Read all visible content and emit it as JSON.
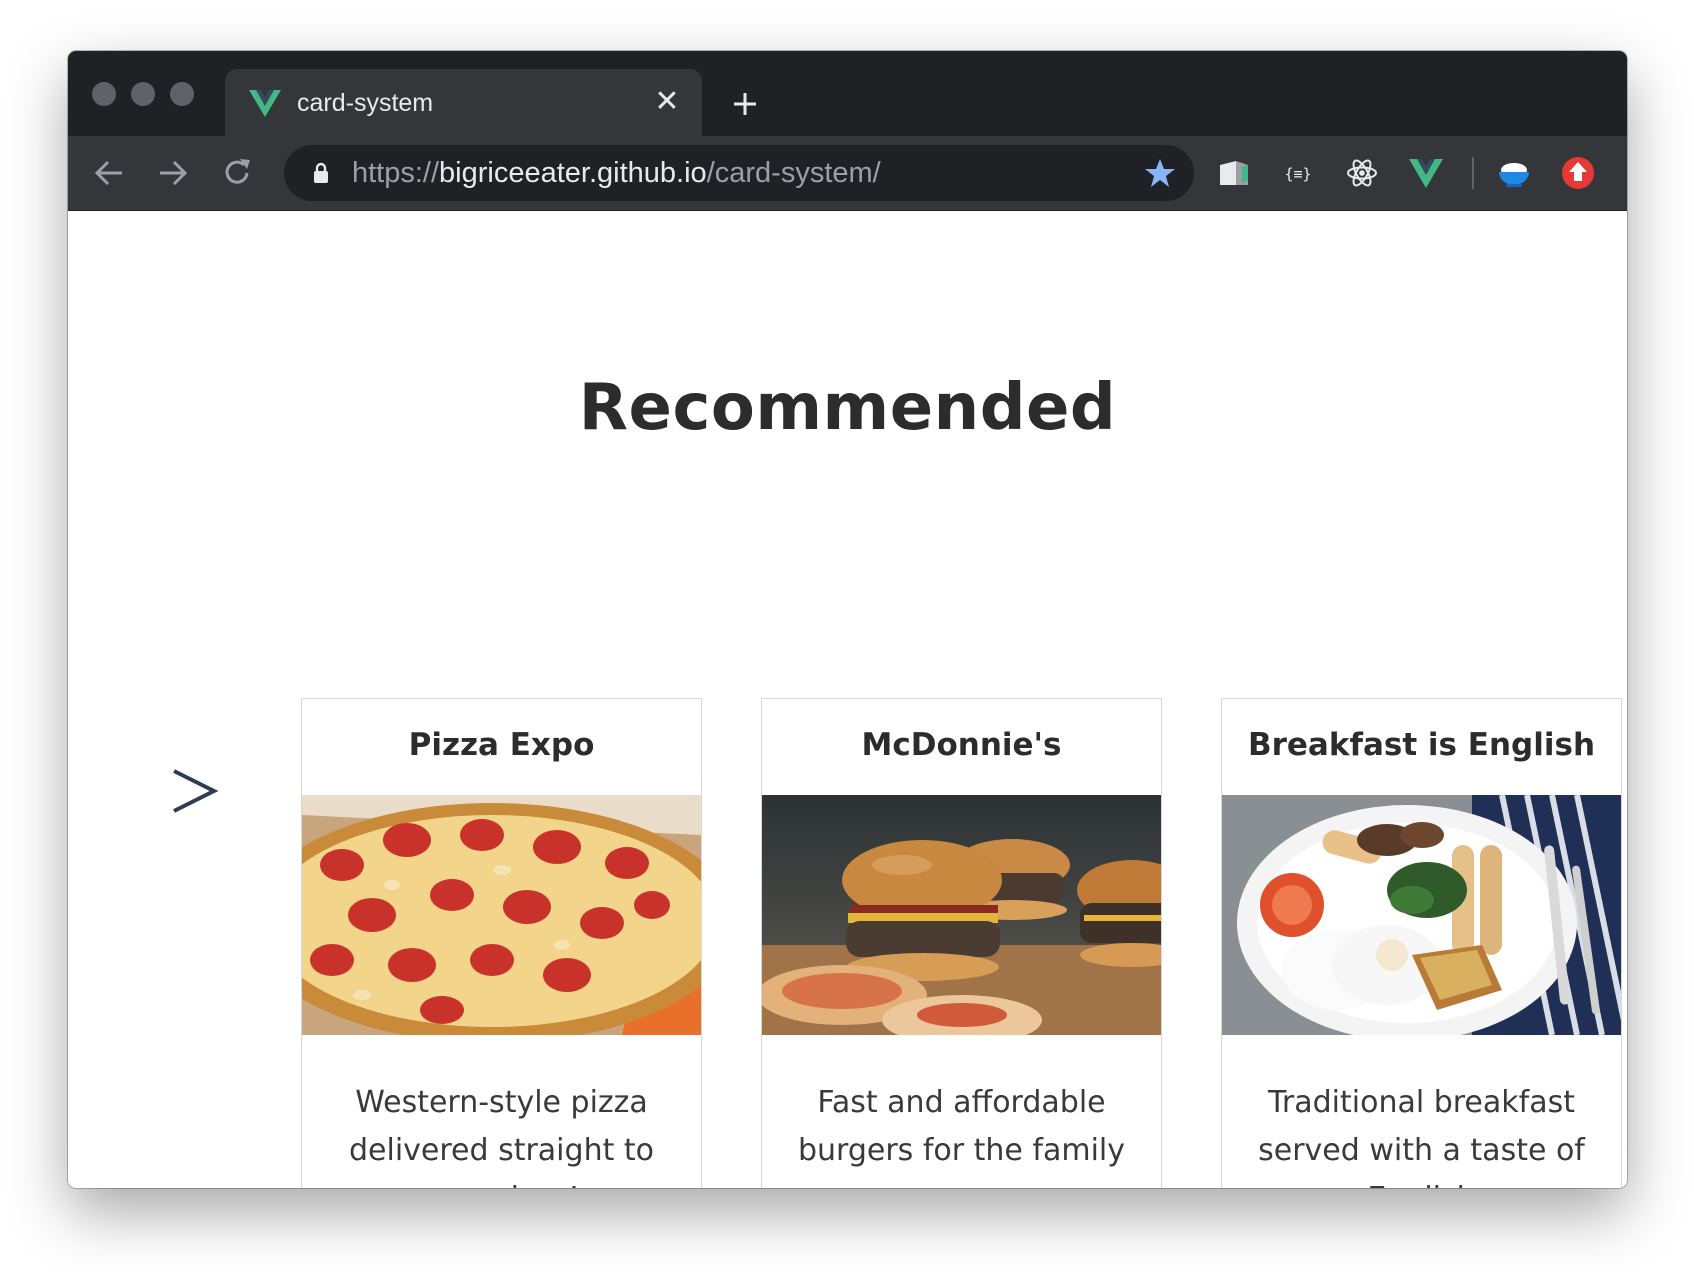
{
  "browser": {
    "tab": {
      "title": "card-system",
      "favicon": "vue-logo-icon",
      "close_glyph": "✕"
    },
    "new_tab_icon": "plus-icon",
    "url": {
      "scheme": "https://",
      "host": "bigriceeater.github.io",
      "path": "/card-system/"
    },
    "extensions": [
      "cube-extension-icon",
      "json-formatter-icon",
      "react-devtools-icon",
      "vue-devtools-icon",
      "rice-bowl-icon",
      "upload-arrow-icon"
    ],
    "colors": {
      "frame": "#202124",
      "toolbar": "#35363a",
      "omnibox": "#202124",
      "star": "#8ab4f8",
      "vue_green": "#42b883",
      "vue_dark": "#35495e",
      "alert_red": "#e53935"
    }
  },
  "page": {
    "title": "Recommended",
    "carousel_arrow": ">",
    "cards": [
      {
        "title": "Pizza Expo",
        "image": "pepperoni-pizza-photo",
        "desc": "Western-style pizza delivered straight to your door!"
      },
      {
        "title": "McDonnie's",
        "image": "burgers-photo",
        "desc": "Fast and affordable burgers for the family"
      },
      {
        "title": "Breakfast is English",
        "image": "english-breakfast-photo",
        "desc": "Traditional breakfast served with a taste of English"
      }
    ]
  }
}
